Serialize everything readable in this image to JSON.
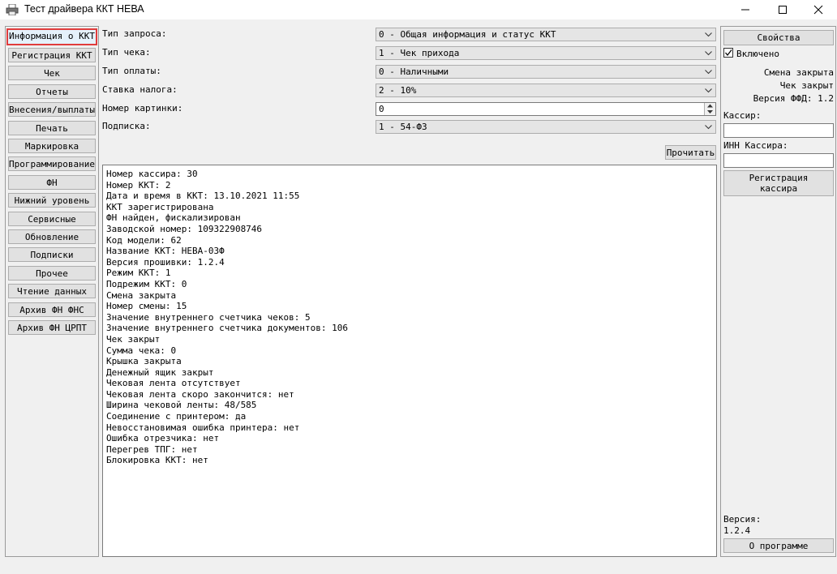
{
  "window": {
    "title": "Тест драйвера ККТ НЕВА",
    "app_icon": "printer-icon"
  },
  "nav": [
    "Информация о ККТ",
    "Регистрация ККТ",
    "Чек",
    "Отчеты",
    "Внесения/выплаты",
    "Печать",
    "Маркировка",
    "Программирование",
    "ФН",
    "Нижний уровень",
    "Сервисные",
    "Обновление",
    "Подписки",
    "Прочее",
    "Чтение данных",
    "Архив ФН ФНС",
    "Архив ФН ЦРПТ"
  ],
  "form": {
    "request_type": {
      "label": "Тип запроса:",
      "value": "0 - Общая информация и статус ККТ"
    },
    "check_type": {
      "label": "Тип чека:",
      "value": "1 - Чек прихода"
    },
    "payment_type": {
      "label": "Тип оплаты:",
      "value": "0 - Наличными"
    },
    "tax_rate": {
      "label": "Ставка налога:",
      "value": "2 - 10%"
    },
    "picture_number": {
      "label": "Номер картинки:",
      "value": "0"
    },
    "subscription": {
      "label": "Подписка:",
      "value": "1 - 54-ФЗ"
    },
    "read_button": "Прочитать"
  },
  "output": [
    "Номер кассира: 30",
    "Номер ККТ: 2",
    "Дата и время в ККТ: 13.10.2021 11:55",
    "ККТ зарегистрирована",
    "ФН найден, фискализирован",
    "Заводской номер: 109322908746",
    "Код модели: 62",
    "Название ККТ: НЕВА-03Ф",
    "Версия прошивки: 1.2.4",
    "Режим ККТ: 1",
    "Подрежим ККТ: 0",
    "Смена закрыта",
    "Номер смены: 15",
    "Значение внутреннего счетчика чеков: 5",
    "Значение внутреннего счетчика документов: 106",
    "Чек закрыт",
    "Сумма чека: 0",
    "Крышка закрыта",
    "Денежный ящик закрыт",
    "Чековая лента отсутствует",
    "Чековая лента скоро закончится: нет",
    "Ширина чековой ленты: 48/585",
    "Соединение с принтером: да",
    "Невосстановимая ошибка принтера: нет",
    "Ошибка отрезчика: нет",
    "Перегрев ТПГ: нет",
    "Блокировка ККТ: нет"
  ],
  "right": {
    "properties_button": "Свойства",
    "enabled_label": "Включено",
    "enabled_checked": true,
    "shift_status": "Смена закрыта",
    "check_status": "Чек закрыт",
    "ffd_version": "Версия ФФД: 1.2",
    "cashier_label": "Кассир:",
    "cashier_value": "",
    "cashier_inn_label": "ИНН Кассира:",
    "cashier_inn_value": "",
    "register_cashier_button": [
      "Регистрация",
      "кассира"
    ],
    "version_label": "Версия:",
    "version_value": "1.2.4",
    "about_button": "О программе"
  }
}
